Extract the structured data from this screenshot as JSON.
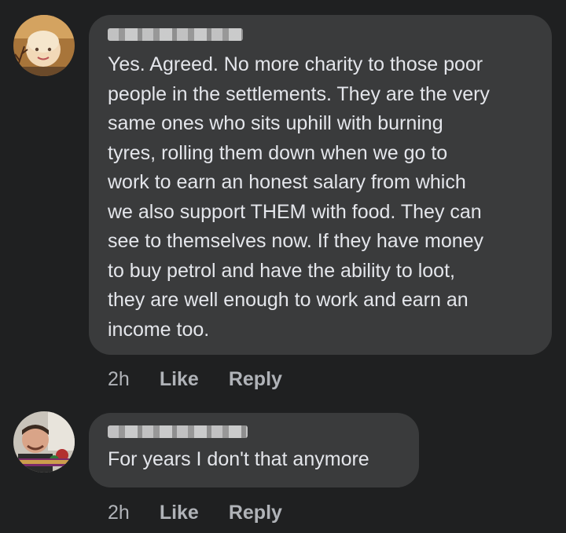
{
  "comments": [
    {
      "avatar_icon": "profile-photo-woman",
      "text": "Yes. Agreed. No more charity to those poor\npeople in the settlements. They are the very\nsame ones who sits uphill with burning\ntyres, rolling them down when we go to\nwork to earn an honest salary from which\nwe also support THEM with food. They can\nsee to themselves now.  If they have money\nto buy petrol and have the ability to loot,\nthey are well enough to work and earn an\nincome too.",
      "time": "2h",
      "like_label": "Like",
      "reply_label": "Reply"
    },
    {
      "avatar_icon": "profile-photo-man",
      "text": "For years I don't that anymore",
      "time": "2h",
      "like_label": "Like",
      "reply_label": "Reply"
    }
  ],
  "colors": {
    "background": "#1f2021",
    "bubble": "#3a3b3c",
    "text": "#e4e6eb",
    "meta": "#b0b3b8"
  }
}
